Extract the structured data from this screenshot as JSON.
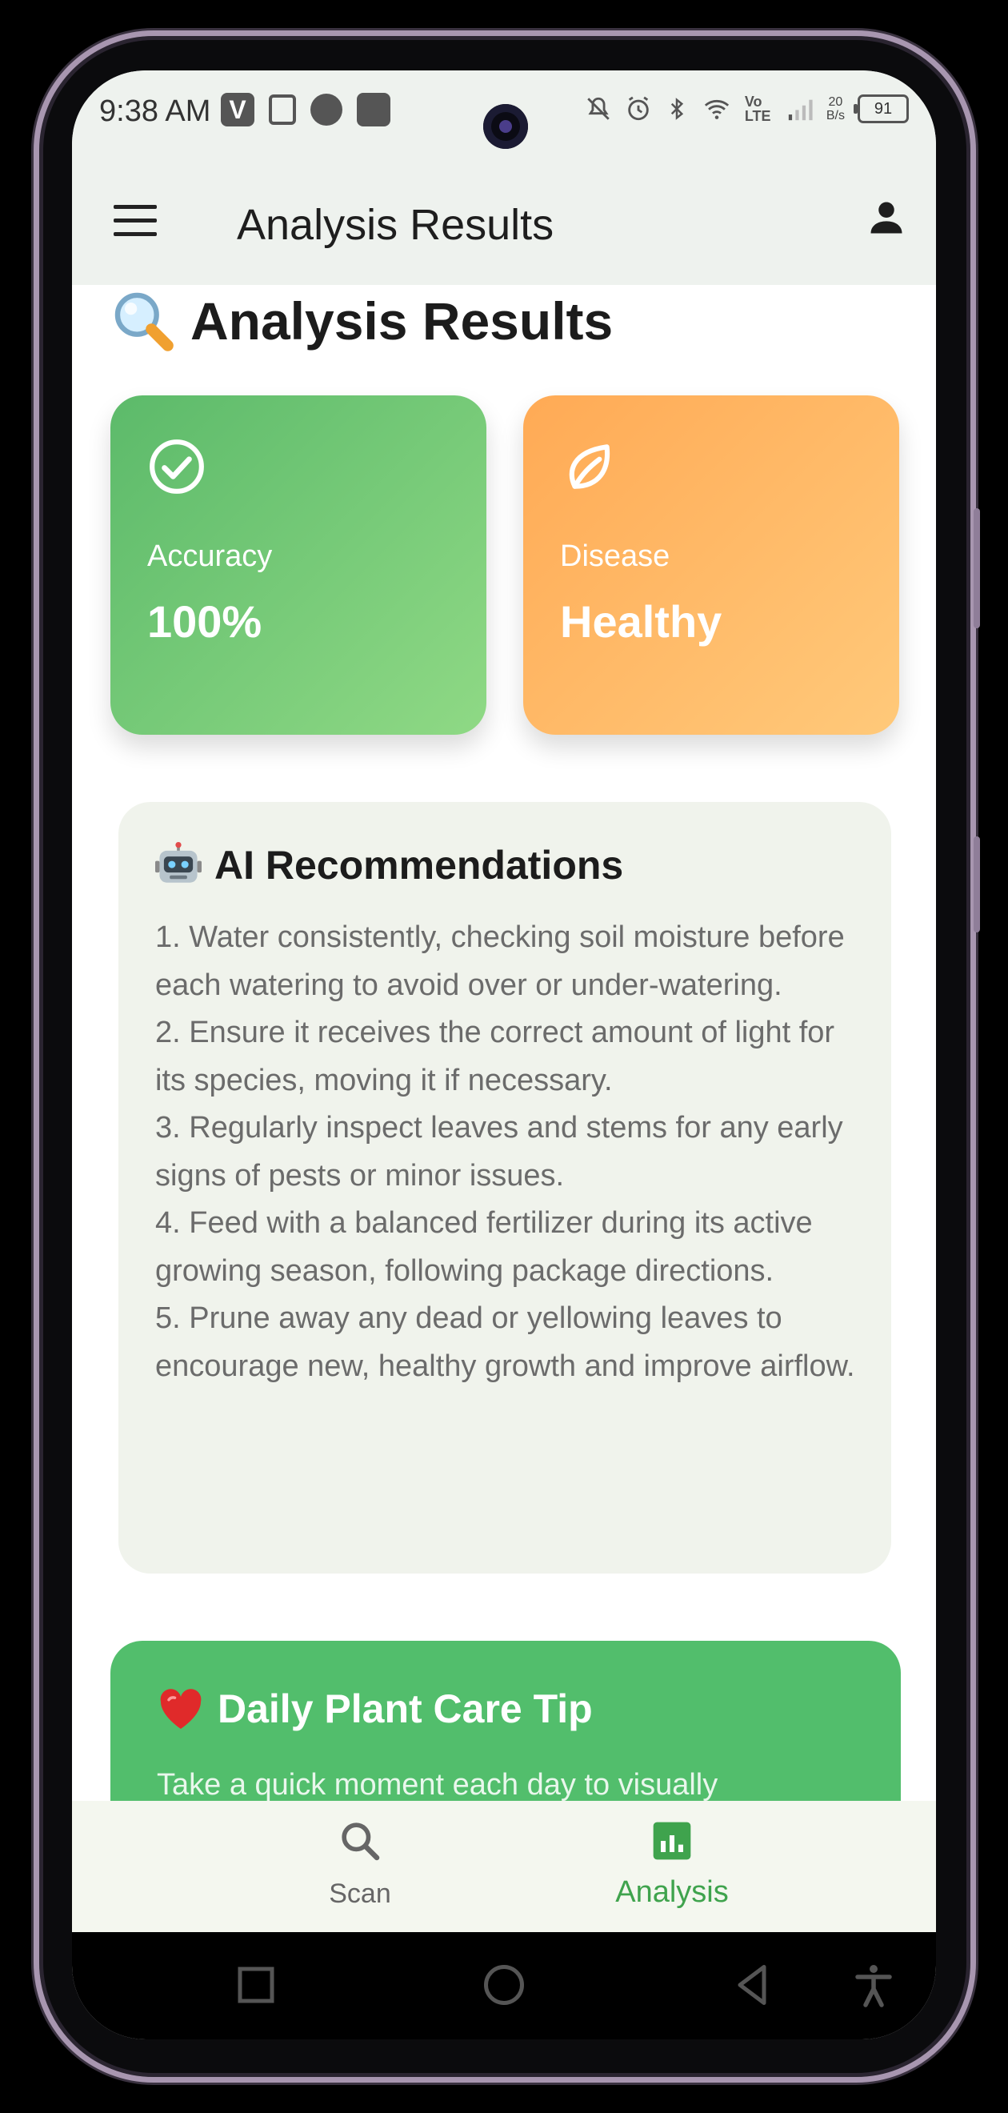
{
  "status_bar": {
    "time": "9:38 AM",
    "icons_left": [
      "v-app-icon",
      "parking-app-icon",
      "circle-notification-icon",
      "square-notification-icon"
    ],
    "icons_right": [
      "mute-icon",
      "alarm-icon",
      "bluetooth-icon",
      "wifi-icon",
      "volte-icon",
      "signal-icon"
    ],
    "volte_label": "Vo LTE",
    "net_rate_value": "20",
    "net_rate_unit": "B/s",
    "battery": "91"
  },
  "app_bar": {
    "title": "Analysis Results",
    "menu_icon": "hamburger-menu-icon",
    "profile_icon": "person-icon"
  },
  "page": {
    "title": "Analysis Results",
    "title_icon": "magnifying-glass-icon"
  },
  "cards": [
    {
      "label": "Accuracy",
      "value": "100%",
      "icon": "check-circle-icon",
      "color": "#5cba6a"
    },
    {
      "label": "Disease",
      "value": "Healthy",
      "icon": "leaf-icon",
      "color": "#ffaa55"
    }
  ],
  "recommendations": {
    "title": "AI Recommendations",
    "title_icon": "robot-icon",
    "items": [
      "1. Water consistently, checking soil moisture before each watering to avoid over or under-watering.",
      "2. Ensure it receives the correct amount of light for its species, moving it if necessary.",
      "3. Regularly inspect leaves and stems for any early signs of pests or minor issues.",
      "4. Feed with a balanced fertilizer during its active growing season, following package directions.",
      "5. Prune away any dead or yellowing leaves to encourage new, healthy growth and improve airflow."
    ]
  },
  "tip": {
    "title": "Daily Plant Care Tip",
    "title_icon": "red-heart-icon",
    "text": "Take a quick moment each day to visually"
  },
  "bottom_nav": {
    "items": [
      {
        "label": "Scan",
        "icon": "search-icon",
        "active": false
      },
      {
        "label": "Analysis",
        "icon": "bar-chart-icon",
        "active": true
      }
    ],
    "active_color": "#3fa34d"
  },
  "system_nav": [
    "recents-square-icon",
    "home-circle-icon",
    "back-triangle-icon",
    "accessibility-icon"
  ]
}
